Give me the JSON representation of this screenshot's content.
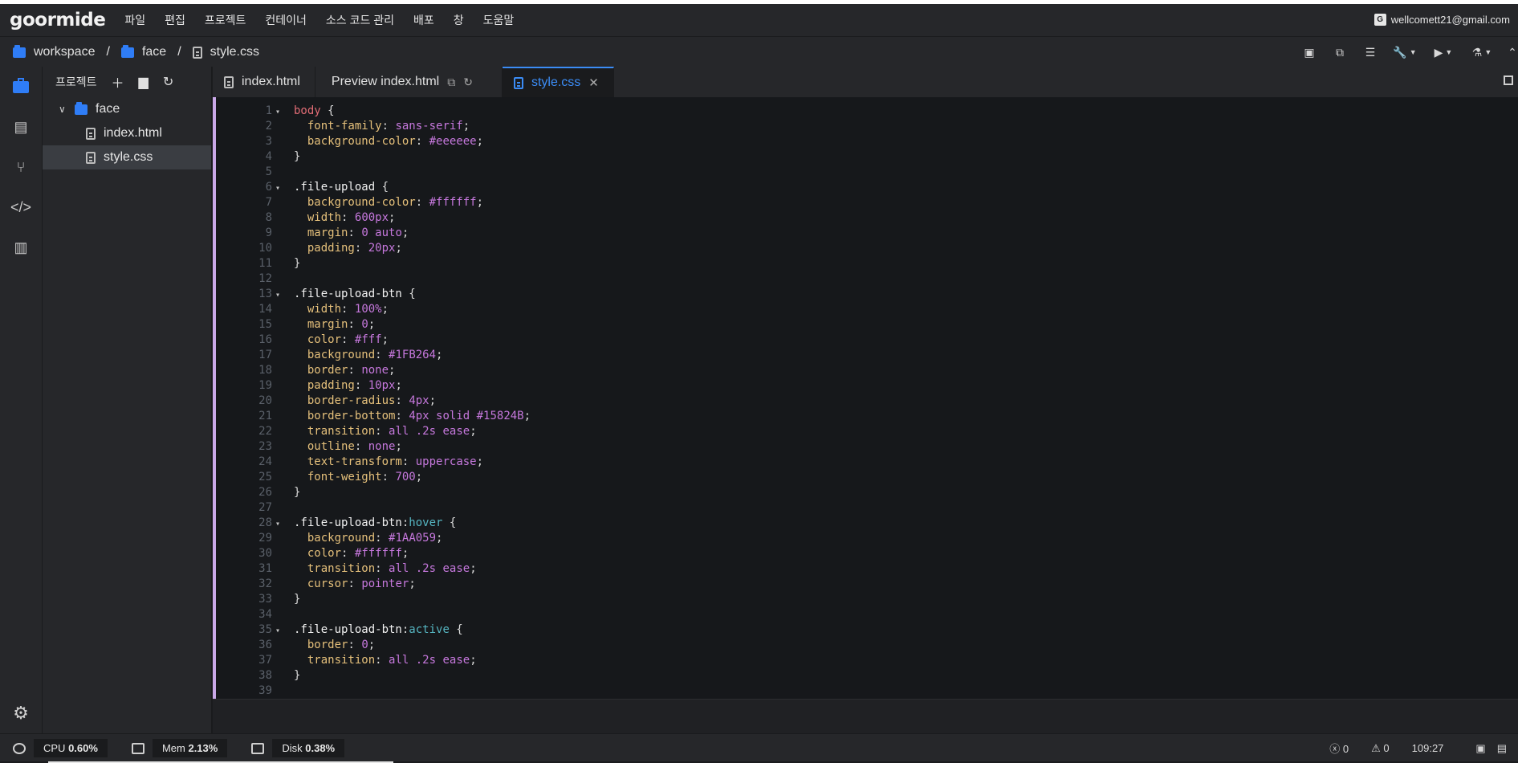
{
  "app": {
    "logo": "goormide",
    "menu": [
      "파일",
      "편집",
      "프로젝트",
      "컨테이너",
      "소스 코드 관리",
      "배포",
      "창",
      "도움말"
    ],
    "user_email": "wellcomett21@gmail.com",
    "user_badge": "G"
  },
  "breadcrumb": {
    "items": [
      "workspace",
      "face",
      "style.css"
    ],
    "separator": "/"
  },
  "explorer": {
    "title": "프로젝트",
    "tree": {
      "folder": "face",
      "files": [
        "index.html",
        "style.css"
      ],
      "selected": "style.css"
    }
  },
  "tabs": [
    {
      "label": "index.html",
      "active": false
    },
    {
      "label": "Preview index.html",
      "active": false
    },
    {
      "label": "style.css",
      "active": true
    }
  ],
  "editor": {
    "lines": [
      "body {",
      "  font-family: sans-serif;",
      "  background-color: #eeeeee;",
      "}",
      "",
      ".file-upload {",
      "  background-color: #ffffff;",
      "  width: 600px;",
      "  margin: 0 auto;",
      "  padding: 20px;",
      "}",
      "",
      ".file-upload-btn {",
      "  width: 100%;",
      "  margin: 0;",
      "  color: #fff;",
      "  background: #1FB264;",
      "  border: none;",
      "  padding: 10px;",
      "  border-radius: 4px;",
      "  border-bottom: 4px solid #15824B;",
      "  transition: all .2s ease;",
      "  outline: none;",
      "  text-transform: uppercase;",
      "  font-weight: 700;",
      "}",
      "",
      ".file-upload-btn:hover {",
      "  background: #1AA059;",
      "  color: #ffffff;",
      "  transition: all .2s ease;",
      "  cursor: pointer;",
      "}",
      "",
      ".file-upload-btn:active {",
      "  border: 0;",
      "  transition: all .2s ease;",
      "}",
      ""
    ],
    "fold_lines": [
      1,
      6,
      13,
      28,
      35
    ]
  },
  "status": {
    "cpu_label": "CPU",
    "cpu_value": "0.60%",
    "mem_label": "Mem",
    "mem_value": "2.13%",
    "disk_label": "Disk",
    "disk_value": "0.38%",
    "errors": "0",
    "warnings": "0",
    "cursor": "109:27"
  },
  "colors": {
    "accent": "#3b8cf5",
    "folder": "#2f7df6"
  }
}
